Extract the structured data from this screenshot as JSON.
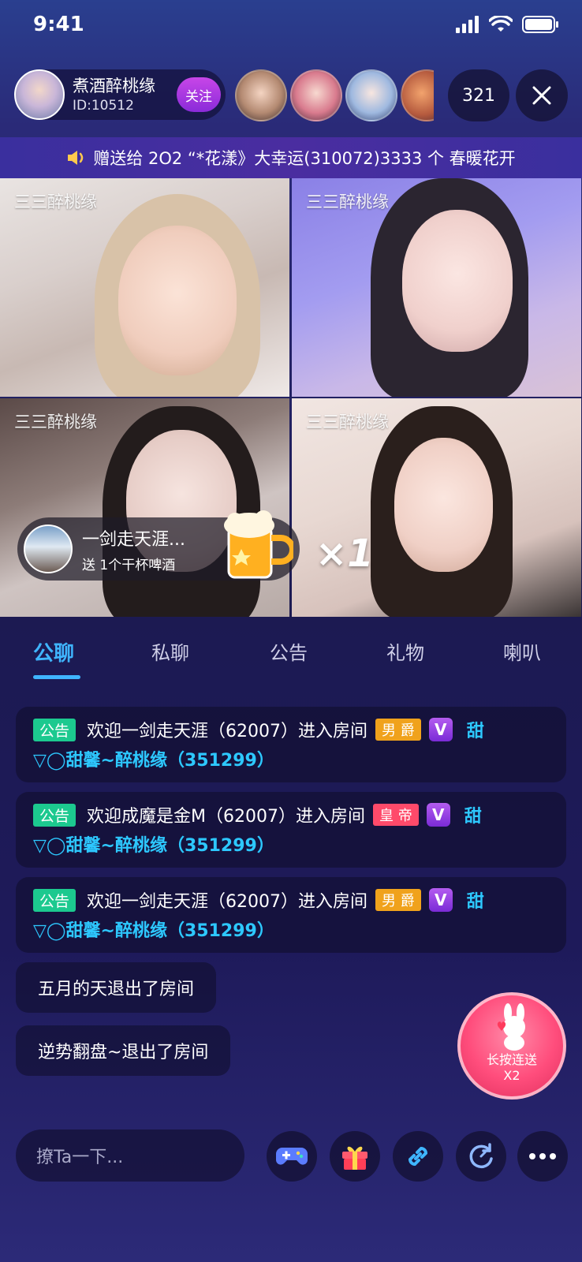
{
  "status_bar": {
    "time": "9:41"
  },
  "host": {
    "name": "煮酒醉桃缘",
    "id": "ID:10512",
    "follow_label": "关注"
  },
  "viewer_count": "321",
  "announcement": "赠送给 2O2 “*花漾》大幸运(310072)3333 个 春暖花开",
  "video_tiles": [
    {
      "label": "三三醉桃缘"
    },
    {
      "label": "三三醉桃缘"
    },
    {
      "label": "三三醉桃缘"
    },
    {
      "label": "三三醉桃缘"
    }
  ],
  "gift_toast": {
    "user": "一剑走天涯...",
    "desc": "送 1个干杯啤酒",
    "combo": "×1"
  },
  "tabs": [
    "公聊",
    "私聊",
    "公告",
    "礼物",
    "喇叭"
  ],
  "messages": [
    {
      "tag": "公告",
      "text": "欢迎一剑走天涯（62007）进入房间",
      "badge": "男 爵",
      "badge_color": "#f0a21c",
      "v": "V",
      "tail": "甜",
      "line2": "▽◯甜馨~醉桃缘（351299）"
    },
    {
      "tag": "公告",
      "text": "欢迎成魔是金M（62007）进入房间",
      "badge": "皇 帝",
      "badge_color": "#ff4a6a",
      "v": "V",
      "tail": "甜",
      "line2": "▽◯甜馨~醉桃缘（351299）"
    },
    {
      "tag": "公告",
      "text": "欢迎一剑走天涯（62007）进入房间",
      "badge": "男 爵",
      "badge_color": "#f0a21c",
      "v": "V",
      "tail": "甜",
      "line2": "▽◯甜馨~醉桃缘（351299）"
    }
  ],
  "exit_messages": [
    "五月的天退出了房间",
    "逆势翻盘~退出了房间"
  ],
  "hold_send": {
    "line1": "长按连送",
    "line2": "X2"
  },
  "input": {
    "placeholder": "撩Ta一下..."
  },
  "colors": {
    "accent": "#3fb5ff",
    "notice_tag": "#1cc98f",
    "name_blue": "#2dc8ff",
    "follow": "#c846e8"
  }
}
